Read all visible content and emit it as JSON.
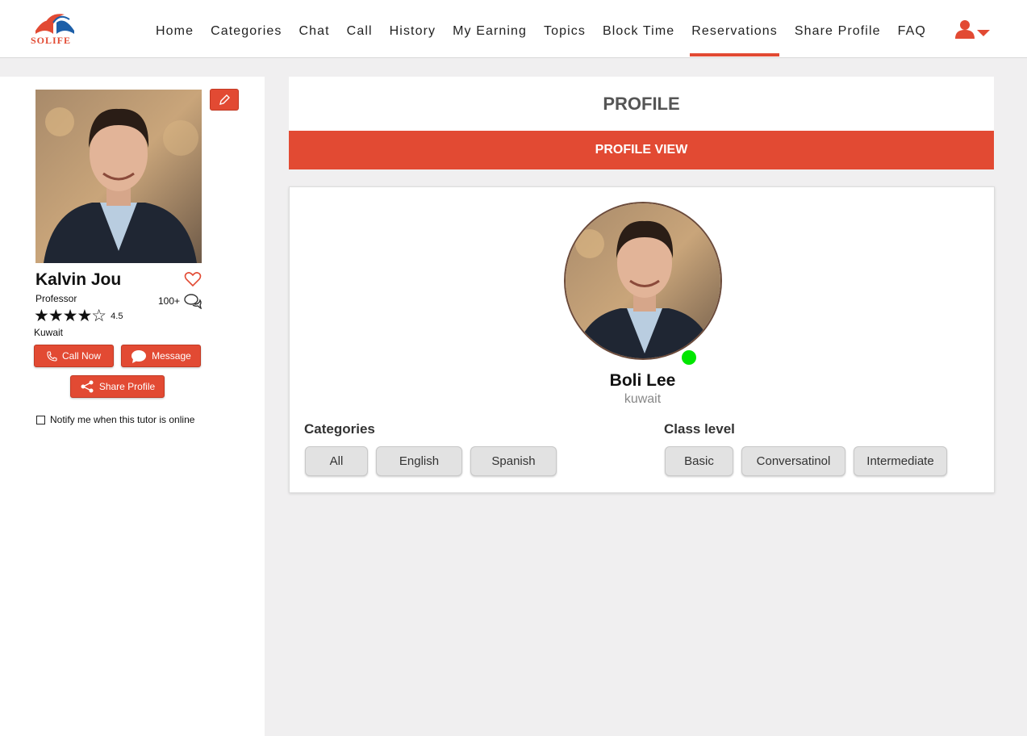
{
  "header": {
    "logo_text": "SOLIFE",
    "nav": [
      {
        "label": "Home"
      },
      {
        "label": "Categories"
      },
      {
        "label": "Chat"
      },
      {
        "label": "Call"
      },
      {
        "label": "History"
      },
      {
        "label": "My Earning"
      },
      {
        "label": "Topics"
      },
      {
        "label": "Block Time"
      },
      {
        "label": "Reservations",
        "active": true
      },
      {
        "label": "Share Profile"
      },
      {
        "label": "FAQ"
      }
    ],
    "user_icon": "user-icon",
    "accent_color": "#e24a33"
  },
  "tutor": {
    "name": "Kalvin Jou",
    "title": "Professor",
    "reviews": "100+",
    "stars": "★★★★☆",
    "rating": "4.5",
    "country": "Kuwait",
    "call_label": "Call Now",
    "message_label": "Message",
    "share_label": "Share Profile",
    "notify_label": "Notify me when this tutor is online"
  },
  "profile": {
    "header": "PROFILE",
    "bar": "PROFILE VIEW",
    "name": "Boli Lee",
    "country": "kuwait",
    "online_color": "#00e600",
    "categories_title": "Categories",
    "categories": [
      "All",
      "English",
      "Spanish"
    ],
    "class_level_title": "Class level",
    "class_levels": [
      "Basic",
      "Conversatinol",
      "Intermediate"
    ]
  }
}
